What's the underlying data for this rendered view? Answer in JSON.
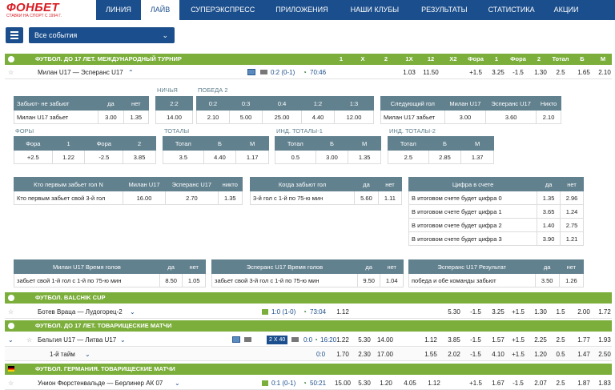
{
  "logo": {
    "text": "ФОНБЕТ",
    "tagline": "СТАВКИ НА СПОРТ С 1994 Г."
  },
  "nav": [
    "ЛИНИЯ",
    "ЛАЙВ",
    "СУПЕРЭКСПРЕСС",
    "ПРИЛОЖЕНИЯ",
    "НАШИ КЛУБЫ",
    "РЕЗУЛЬТАТЫ",
    "СТАТИСТИКА",
    "АКЦИИ"
  ],
  "filter": {
    "selected": "Все события"
  },
  "headers": [
    "1",
    "X",
    "2",
    "1X",
    "12",
    "X2",
    "Фора",
    "1",
    "Фора",
    "2",
    "Тотал",
    "Б",
    "М"
  ],
  "sections": [
    "ФУТБОЛ. ДО 17 ЛЕТ. МЕЖДУНАРОДНЫЙ ТУРНИР",
    "ФУТБОЛ. BALCHIK CUP",
    "ФУТБОЛ. ДО 17 ЛЕТ. ТОВАРИЩЕСКИЕ МАТЧИ",
    "ФУТБОЛ. ГЕРМАНИЯ. ТОВАРИЩЕСКИЕ МАТЧИ"
  ],
  "rows": [
    {
      "name": "Милан U17 — Эсперанс U17",
      "score": "0:2 (0-1)",
      "time": "70:46",
      "odds": [
        "",
        "",
        "",
        "1.03",
        "11.50",
        "",
        "+1.5",
        "3.25",
        "-1.5",
        "1.30",
        "2.5",
        "1.65",
        "2.10"
      ]
    },
    {
      "name": "Ботев Враца — Лудогорец-2",
      "score": "1:0 (1-0)",
      "time": "73:04",
      "odds": [
        "1.12",
        "",
        "",
        "",
        "5.30",
        "-1.5",
        "3.25",
        "+1.5",
        "1.30",
        "1.5",
        "",
        "2.00",
        "1.72"
      ]
    },
    {
      "name": "Бельгия U17 — Литва U17",
      "badge": "2 X 40",
      "score": "0:0",
      "time": "16:20",
      "odds": [
        "1.22",
        "5.30",
        "14.00",
        "",
        "1.12",
        "3.85",
        "-1.5",
        "1.57",
        "+1.5",
        "2.25",
        "2.5",
        "1.77",
        "1.93"
      ]
    },
    {
      "name": "1-й тайм",
      "score": "0:0",
      "time": "",
      "odds": [
        "1.70",
        "2.30",
        "17.00",
        "",
        "1.55",
        "2.02",
        "-1.5",
        "4.10",
        "+1.5",
        "1.20",
        "0.5",
        "1.47",
        "2.50"
      ]
    },
    {
      "name": "Унион Фюрстенвальде — Берлинер АК 07",
      "score": "0:1 (0-1)",
      "time": "50:21",
      "odds": [
        "15.00",
        "5.30",
        "1.20",
        "4.05",
        "1.12",
        "",
        "+1.5",
        "1.67",
        "-1.5",
        "2.07",
        "2.5",
        "1.87",
        "1.83"
      ]
    }
  ],
  "t1": {
    "h": [
      "Забьют- не забьют",
      "да",
      "нет"
    ],
    "r": [
      "Милан U17 забьет",
      "3.00",
      "1.35"
    ]
  },
  "t2": {
    "lbl": "НИЧЬЯ",
    "h": "2:2",
    "v": "14.00"
  },
  "t3": {
    "lbl": "ПОБЕДА 2",
    "h": [
      "0:2",
      "0:3",
      "0:4",
      "1:2",
      "1:3"
    ],
    "r": [
      "2.10",
      "5.00",
      "25.00",
      "4.40",
      "12.00"
    ]
  },
  "t4": {
    "h": [
      "Следующий гол",
      "Милан U17",
      "Эсперанс U17",
      "Никто"
    ],
    "r": [
      "Милан U17 забьет",
      "3.00",
      "3.60",
      "2.10"
    ]
  },
  "t5": {
    "lbl": "ФОРЫ",
    "h": [
      "Фора",
      "1",
      "Фора",
      "2"
    ],
    "r": [
      "+2.5",
      "1.22",
      "-2.5",
      "3.85"
    ]
  },
  "t6": {
    "lbl": "ТОТАЛЫ",
    "h": [
      "Тотал",
      "Б",
      "М"
    ],
    "r": [
      "3.5",
      "4.40",
      "1.17"
    ]
  },
  "t7": {
    "lbl": "ИНД. ТОТАЛЫ-1",
    "h": [
      "Тотал",
      "Б",
      "М"
    ],
    "r": [
      "0.5",
      "3.00",
      "1.35"
    ]
  },
  "t8": {
    "lbl": "ИНД. ТОТАЛЫ-2",
    "h": [
      "Тотал",
      "Б",
      "М"
    ],
    "r": [
      "2.5",
      "2.85",
      "1.37"
    ]
  },
  "t9": {
    "h": [
      "Кто первым забьет гол N",
      "Милан U17",
      "Эсперанс U17",
      "никто"
    ],
    "r": [
      "Кто первым забьет свой 3-й гол",
      "16.00",
      "2.70",
      "1.35"
    ]
  },
  "t10": {
    "h": [
      "Когда забьют гол",
      "да",
      "нет"
    ],
    "r": [
      "3-й гол с 1-й по 75-ю мин",
      "5.60",
      "1.11"
    ]
  },
  "t11": {
    "h": [
      "Цифра в счете",
      "да",
      "нет"
    ],
    "rows": [
      [
        "В итоговом счете будет цифра 0",
        "1.35",
        "2.96"
      ],
      [
        "В итоговом счете будет цифра 1",
        "3.65",
        "1.24"
      ],
      [
        "В итоговом счете будет цифра 2",
        "1.40",
        "2.75"
      ],
      [
        "В итоговом счете будет цифра 3",
        "3.90",
        "1.21"
      ]
    ]
  },
  "t12": {
    "h": [
      "Милан U17 Время голов",
      "да",
      "нет"
    ],
    "r": [
      "забьет свой 1-й гол с 1-й по 75-ю мин",
      "8.50",
      "1.05"
    ]
  },
  "t13": {
    "h": [
      "Эсперанс U17 Время голов",
      "да",
      "нет"
    ],
    "r": [
      "забьет свой 3-й гол с 1-й по 75-ю мин",
      "9.50",
      "1.04"
    ]
  },
  "t14": {
    "h": [
      "Эсперанс U17 Результат",
      "да",
      "нет"
    ],
    "r": [
      "победа и обе команды забьют",
      "3.50",
      "1.26"
    ]
  }
}
